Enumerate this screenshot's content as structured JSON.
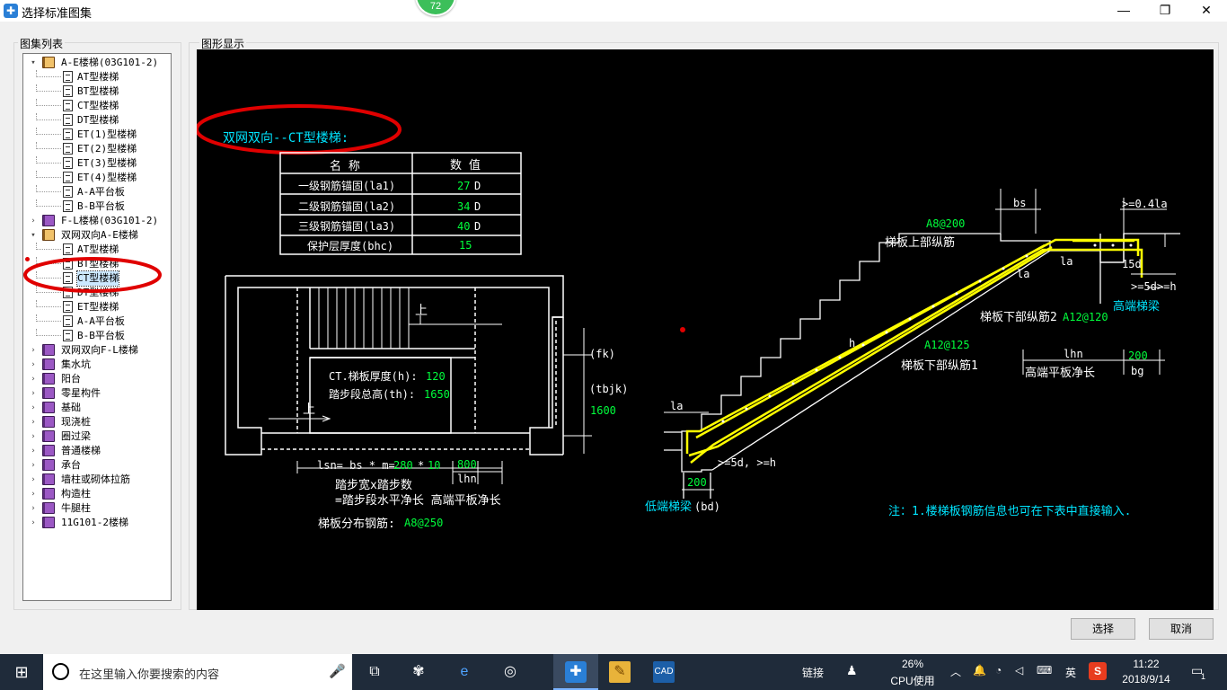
{
  "window": {
    "title": "选择标准图集",
    "badge": "72",
    "minimize": "—",
    "maximize": "❐",
    "close": "✕"
  },
  "left_group": {
    "label": "图集列表"
  },
  "right_group": {
    "label": "图形显示"
  },
  "tree": {
    "items": [
      {
        "label": "A-E楼梯(03G101-2)",
        "level": 0,
        "expander": "▾",
        "icon": "book-open-icon"
      },
      {
        "label": "AT型楼梯",
        "level": 1,
        "icon": "doc-icon"
      },
      {
        "label": "BT型楼梯",
        "level": 1,
        "icon": "doc-icon"
      },
      {
        "label": "CT型楼梯",
        "level": 1,
        "icon": "doc-icon"
      },
      {
        "label": "DT型楼梯",
        "level": 1,
        "icon": "doc-icon"
      },
      {
        "label": "ET(1)型楼梯",
        "level": 1,
        "icon": "doc-icon"
      },
      {
        "label": "ET(2)型楼梯",
        "level": 1,
        "icon": "doc-icon"
      },
      {
        "label": "ET(3)型楼梯",
        "level": 1,
        "icon": "doc-icon"
      },
      {
        "label": "ET(4)型楼梯",
        "level": 1,
        "icon": "doc-icon"
      },
      {
        "label": "A-A平台板",
        "level": 1,
        "icon": "doc-icon"
      },
      {
        "label": "B-B平台板",
        "level": 1,
        "icon": "doc-icon"
      },
      {
        "label": "F-L楼梯(03G101-2)",
        "level": 0,
        "expander": "›",
        "icon": "book-closed-icon"
      },
      {
        "label": "双网双向A-E楼梯",
        "level": 0,
        "expander": "▾",
        "icon": "book-open-icon"
      },
      {
        "label": "AT型楼梯",
        "level": 1,
        "icon": "doc-icon"
      },
      {
        "label": "BT型楼梯",
        "level": 1,
        "icon": "doc-icon"
      },
      {
        "label": "CT型楼梯",
        "level": 1,
        "icon": "doc-icon",
        "selected": true
      },
      {
        "label": "DT型楼梯",
        "level": 1,
        "icon": "doc-icon"
      },
      {
        "label": "ET型楼梯",
        "level": 1,
        "icon": "doc-icon"
      },
      {
        "label": "A-A平台板",
        "level": 1,
        "icon": "doc-icon"
      },
      {
        "label": "B-B平台板",
        "level": 1,
        "icon": "doc-icon"
      },
      {
        "label": "双网双向F-L楼梯",
        "level": 0,
        "expander": "›",
        "icon": "book-closed-icon"
      },
      {
        "label": "集水坑",
        "level": 0,
        "expander": "›",
        "icon": "book-closed-icon"
      },
      {
        "label": "阳台",
        "level": 0,
        "expander": "›",
        "icon": "book-closed-icon"
      },
      {
        "label": "零星构件",
        "level": 0,
        "expander": "›",
        "icon": "book-closed-icon"
      },
      {
        "label": "基础",
        "level": 0,
        "expander": "›",
        "icon": "book-closed-icon"
      },
      {
        "label": "现浇桩",
        "level": 0,
        "expander": "›",
        "icon": "book-closed-icon"
      },
      {
        "label": "圈过梁",
        "level": 0,
        "expander": "›",
        "icon": "book-closed-icon"
      },
      {
        "label": "普通楼梯",
        "level": 0,
        "expander": "›",
        "icon": "book-closed-icon"
      },
      {
        "label": "承台",
        "level": 0,
        "expander": "›",
        "icon": "book-closed-icon"
      },
      {
        "label": "墙柱或砌体拉筋",
        "level": 0,
        "expander": "›",
        "icon": "book-closed-icon"
      },
      {
        "label": "构造柱",
        "level": 0,
        "expander": "›",
        "icon": "book-closed-icon"
      },
      {
        "label": "牛腿柱",
        "level": 0,
        "expander": "›",
        "icon": "book-closed-icon"
      },
      {
        "label": "11G101-2楼梯",
        "level": 0,
        "expander": "›",
        "icon": "book-closed-icon"
      }
    ]
  },
  "drawing": {
    "title": "双网双向--CT型楼梯:",
    "table": {
      "headers": [
        "名 称",
        "数 值"
      ],
      "rows": [
        {
          "name": "一级钢筋锚固(la1)",
          "value": "27",
          "unit": "D"
        },
        {
          "name": "二级钢筋锚固(la2)",
          "value": "34",
          "unit": "D"
        },
        {
          "name": "三级钢筋锚固(la3)",
          "value": "40",
          "unit": "D"
        },
        {
          "name": "保护层厚度(bhc)",
          "value": "15",
          "unit": ""
        }
      ]
    },
    "plan": {
      "up1": "上",
      "up2": "上",
      "thickness_label": "CT.梯板厚度(h):",
      "thickness_value": "120",
      "height_label": "踏步段总高(th):",
      "height_value": "1650",
      "fk": "(fk)",
      "tbjk": "(tbjk)",
      "tbjk_value": "1600",
      "lsn_label": "lsn= bs * m=",
      "bs_value": "280",
      "times": "*",
      "m_value": "10",
      "lhn_value": "800",
      "lhn": "lhn",
      "note1": "踏步宽x踏步数",
      "note2": "=踏步段水平净长 高端平板净长",
      "dist_label": "梯板分布钢筋:",
      "dist_value": "A8@250"
    },
    "section": {
      "top_rebar_value": "A8@200",
      "top_rebar_label": "梯板上部纵筋",
      "bs": "bs",
      "ge04la": ">=0.4la",
      "la1": "la",
      "la2": "la",
      "la3": "la",
      "d15": "15d",
      "ge5d": ">=5d>=h",
      "high_beam": "高端梯梁",
      "bottom2_label": "梯板下部纵筋2",
      "bottom2_value": "A12@120",
      "bottom1_value": "A12@125",
      "bottom1_label": "梯板下部纵筋1",
      "h": "h",
      "lhn": "lhn",
      "high_plate": "高端平板净长",
      "bg_value": "200",
      "bg": "bg",
      "ge5d_h": ">=5d, >=h",
      "bd_value": "200",
      "low_beam": "低端梯梁",
      "bd": "(bd)"
    },
    "note": "注：1.楼梯板钢筋信息也可在下表中直接输入.",
    "colors": {
      "white": "#ffffff",
      "green": "#00ff3c",
      "cyan": "#00e5ff",
      "yellow": "#ffff00",
      "red": "#e00000"
    }
  },
  "buttons": {
    "select": "选择",
    "cancel": "取消"
  },
  "taskbar": {
    "search_placeholder": "在这里输入你要搜索的内容",
    "link": "链接",
    "cpu_percent": "26%",
    "cpu_label": "CPU使用",
    "ime": "英",
    "time": "11:22",
    "date": "2018/9/14",
    "notif_count": "1"
  }
}
